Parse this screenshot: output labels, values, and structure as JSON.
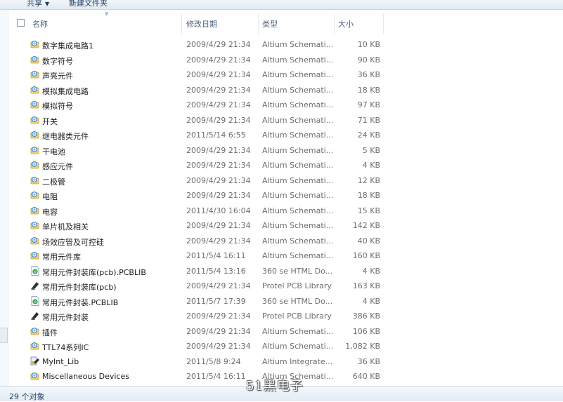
{
  "toolbar": {
    "share_label": "共享",
    "newfolder_label": "新建文件夹"
  },
  "columns": {
    "name": "名称",
    "date": "修改日期",
    "type": "类型",
    "size": "大小"
  },
  "files": [
    {
      "name": "数字集成电路1",
      "date": "2009/4/29 21:34",
      "type": "Altium Schemati...",
      "size": "10 KB",
      "icon": "schematic-library-icon"
    },
    {
      "name": "数字符号",
      "date": "2009/4/29 21:34",
      "type": "Altium Schemati...",
      "size": "90 KB",
      "icon": "schematic-library-icon"
    },
    {
      "name": "声亮元件",
      "date": "2009/4/29 21:34",
      "type": "Altium Schemati...",
      "size": "36 KB",
      "icon": "schematic-library-icon"
    },
    {
      "name": "模拟集成电路",
      "date": "2009/4/29 21:34",
      "type": "Altium Schemati...",
      "size": "18 KB",
      "icon": "schematic-library-icon"
    },
    {
      "name": "模拟符号",
      "date": "2009/4/29 21:34",
      "type": "Altium Schemati...",
      "size": "97 KB",
      "icon": "schematic-library-icon"
    },
    {
      "name": "开关",
      "date": "2009/4/29 21:34",
      "type": "Altium Schemati...",
      "size": "71 KB",
      "icon": "schematic-library-icon"
    },
    {
      "name": "继电器类元件",
      "date": "2011/5/14 6:55",
      "type": "Altium Schemati...",
      "size": "24 KB",
      "icon": "schematic-library-icon"
    },
    {
      "name": "干电池",
      "date": "2009/4/29 21:34",
      "type": "Altium Schemati...",
      "size": "5 KB",
      "icon": "schematic-library-icon"
    },
    {
      "name": "感应元件",
      "date": "2009/4/29 21:34",
      "type": "Altium Schemati...",
      "size": "4 KB",
      "icon": "schematic-library-icon"
    },
    {
      "name": "二极管",
      "date": "2009/4/29 21:34",
      "type": "Altium Schemati...",
      "size": "12 KB",
      "icon": "schematic-library-icon"
    },
    {
      "name": "电阻",
      "date": "2009/4/29 21:34",
      "type": "Altium Schemati...",
      "size": "18 KB",
      "icon": "schematic-library-icon"
    },
    {
      "name": "电容",
      "date": "2011/4/30 16:04",
      "type": "Altium Schemati...",
      "size": "15 KB",
      "icon": "schematic-library-icon"
    },
    {
      "name": "单片机及相关",
      "date": "2009/4/29 21:34",
      "type": "Altium Schemati...",
      "size": "142 KB",
      "icon": "schematic-library-icon"
    },
    {
      "name": "场效应管及可控硅",
      "date": "2009/4/29 21:34",
      "type": "Altium Schemati...",
      "size": "40 KB",
      "icon": "schematic-library-icon"
    },
    {
      "name": "常用元件库",
      "date": "2011/5/4 16:11",
      "type": "Altium Schemati...",
      "size": "160 KB",
      "icon": "schematic-library-icon"
    },
    {
      "name": "常用元件封装库(pcb).PCBLIB",
      "date": "2011/5/4 13:16",
      "type": "360 se HTML Do...",
      "size": "4 KB",
      "icon": "html-document-icon"
    },
    {
      "name": "常用元件封装库(pcb)",
      "date": "2009/4/29 21:34",
      "type": "Protel PCB Library",
      "size": "163 KB",
      "icon": "pcb-library-icon"
    },
    {
      "name": "常用元件封装.PCBLIB",
      "date": "2011/5/7 17:39",
      "type": "360 se HTML Do...",
      "size": "4 KB",
      "icon": "html-document-icon"
    },
    {
      "name": "常用元件封装",
      "date": "2009/4/29 21:34",
      "type": "Protel PCB Library",
      "size": "386 KB",
      "icon": "pcb-library-icon"
    },
    {
      "name": "插件",
      "date": "2009/4/29 21:34",
      "type": "Altium Schemati...",
      "size": "106 KB",
      "icon": "schematic-library-icon"
    },
    {
      "name": "TTL74系列IC",
      "date": "2009/4/29 21:34",
      "type": "Altium Schemati...",
      "size": "1,082 KB",
      "icon": "schematic-library-icon"
    },
    {
      "name": "MyInt_Lib",
      "date": "2011/5/8 9:24",
      "type": "Altium Integrate...",
      "size": "36 KB",
      "icon": "integrated-library-icon"
    },
    {
      "name": "Miscellaneous Devices",
      "date": "2011/5/4 16:11",
      "type": "Altium Schemati...",
      "size": "640 KB",
      "icon": "schematic-library-icon"
    }
  ],
  "status": {
    "count_text": "29 个对象"
  },
  "watermark": "51黑电子",
  "colors": {
    "link_blue": "#1e395b",
    "status_bg": "#e3ebf5",
    "icon_blue": "#3b86d8",
    "icon_orange": "#f0a030"
  }
}
